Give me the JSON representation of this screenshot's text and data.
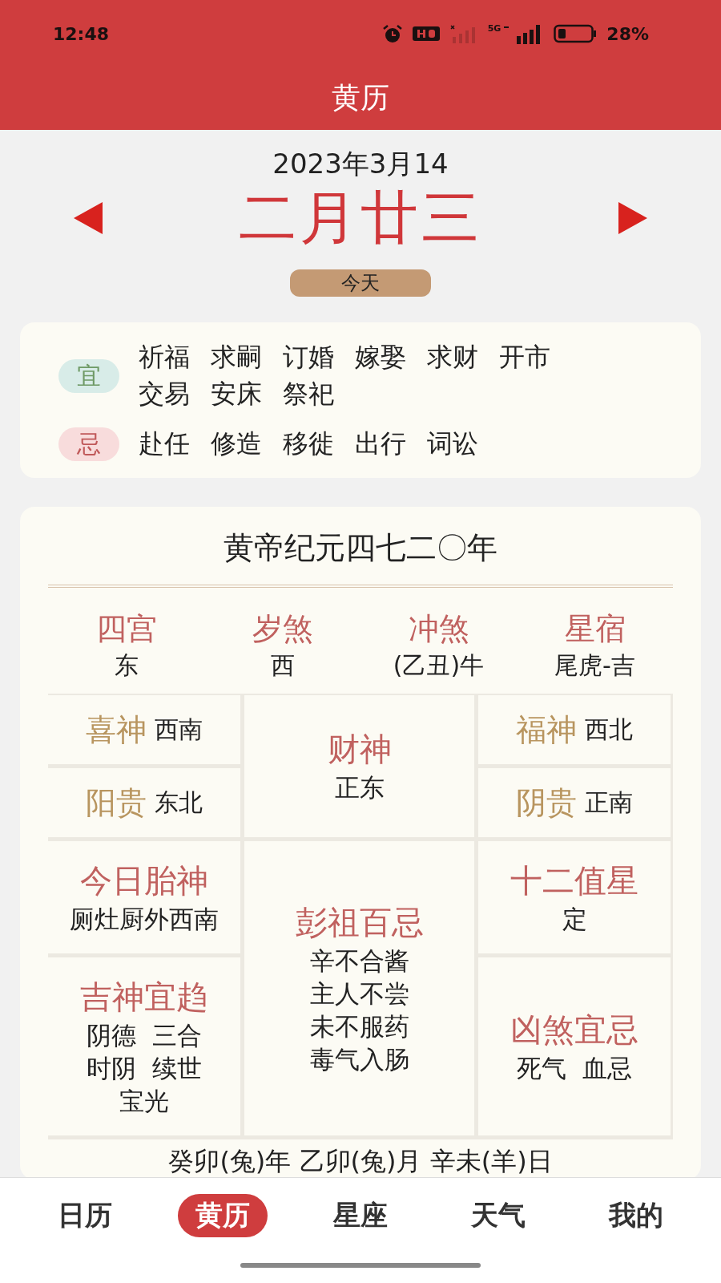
{
  "status_bar": {
    "time": "12:48",
    "battery": "28%",
    "network": "5G"
  },
  "header": {
    "title": "黄历"
  },
  "date": {
    "solar": "2023年3月14",
    "lunar": "二月廿三",
    "today_button": "今天"
  },
  "yiji": [
    {
      "kind": "yi",
      "label": "宜",
      "items": [
        "祈福",
        "求嗣",
        "订婚",
        "嫁娶",
        "求财",
        "开市",
        "交易",
        "安床",
        "祭祀"
      ]
    },
    {
      "kind": "ji",
      "label": "忌",
      "items": [
        "赴任",
        "修造",
        "移徙",
        "出行",
        "词讼"
      ]
    }
  ],
  "almanac": {
    "era": "黄帝纪元四七二〇年",
    "directions": [
      {
        "title": "四宫",
        "value": "东"
      },
      {
        "title": "岁煞",
        "value": "西"
      },
      {
        "title": "冲煞",
        "value": "(乙丑)牛"
      },
      {
        "title": "星宿",
        "value": "尾虎-吉"
      }
    ],
    "cells": [
      {
        "kind": "inline",
        "title": "喜神",
        "lines": [
          "西南"
        ]
      },
      {
        "kind": "center",
        "title": "财神",
        "lines": [
          "正东"
        ]
      },
      {
        "kind": "inline",
        "title": "福神",
        "lines": [
          "西北"
        ]
      },
      {
        "kind": "inline",
        "title": "阳贵",
        "lines": [
          "东北"
        ]
      },
      {
        "kind": "inline",
        "title": "阴贵",
        "lines": [
          "正南"
        ]
      },
      {
        "kind": "stacked",
        "title": "今日胎神",
        "lines": [
          "厕灶厨外西南"
        ]
      },
      {
        "kind": "center",
        "title": "彭祖百忌",
        "lines": [
          "辛不合酱",
          "主人不尝",
          "未不服药",
          "毒气入肠"
        ]
      },
      {
        "kind": "stacked",
        "title": "十二值星",
        "lines": [
          "定"
        ]
      },
      {
        "kind": "stacked",
        "title": "吉神宜趋",
        "lines": [
          "阴德  三合",
          "时阴  续世",
          "宝光"
        ]
      },
      {
        "kind": "stacked",
        "title": "凶煞宜忌",
        "lines": [
          "死气  血忌"
        ]
      }
    ],
    "ganzhi": "癸卯(兔)年 乙卯(兔)月 辛未(羊)日"
  },
  "nav": [
    {
      "label": "日历",
      "selected": false
    },
    {
      "label": "黄历",
      "selected": true
    },
    {
      "label": "星座",
      "selected": false
    },
    {
      "label": "天气",
      "selected": false
    },
    {
      "label": "我的",
      "selected": false
    }
  ]
}
